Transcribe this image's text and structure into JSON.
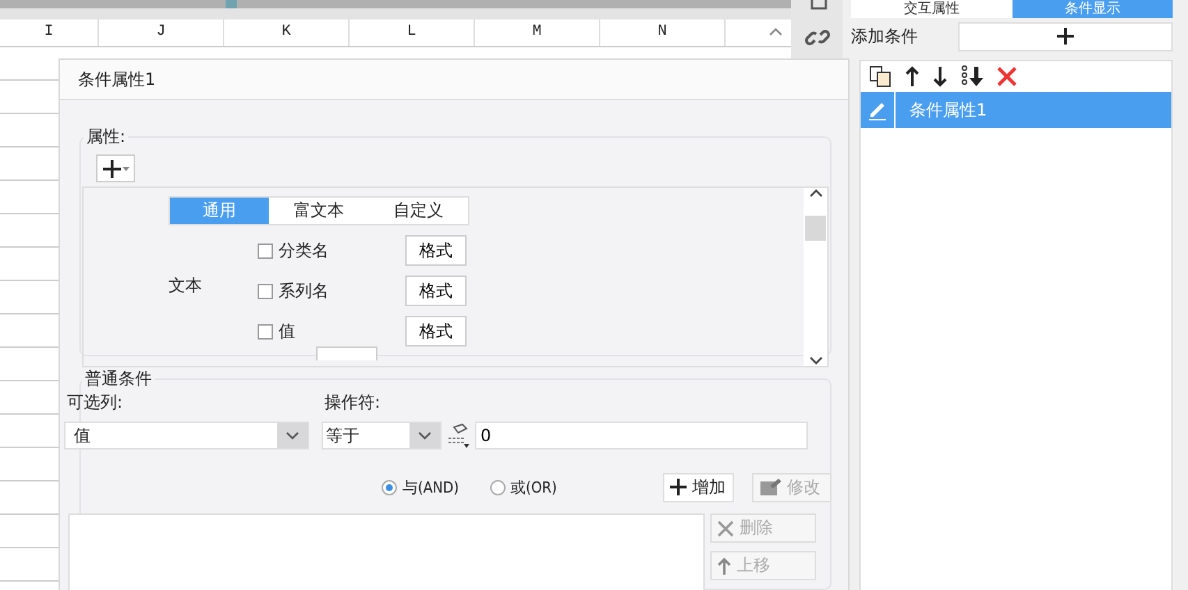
{
  "spreadsheet": {
    "columns": [
      "I",
      "J",
      "K",
      "L",
      "M",
      "N"
    ]
  },
  "side_panel": {
    "tabs": [
      {
        "label": "交互属性",
        "selected": false
      },
      {
        "label": "条件显示",
        "selected": true
      }
    ],
    "add_label": "添加条件",
    "conditions": [
      {
        "label": "条件属性1",
        "selected": true
      }
    ]
  },
  "dialog": {
    "title": "条件属性1",
    "properties": {
      "legend": "属性:",
      "tabs": [
        {
          "label": "通用",
          "selected": true
        },
        {
          "label": "富文本",
          "selected": false
        },
        {
          "label": "自定义",
          "selected": false
        }
      ],
      "section_label": "文本",
      "items": [
        {
          "label": "分类名",
          "checked": false,
          "button": "格式"
        },
        {
          "label": "系列名",
          "checked": false,
          "button": "格式"
        },
        {
          "label": "值",
          "checked": false,
          "button": "格式"
        }
      ]
    },
    "condition": {
      "legend": "普通条件",
      "column_label": "可选列:",
      "column_value": "值",
      "operator_label": "操作符:",
      "operator_value": "等于",
      "value": "0",
      "logic": [
        {
          "label": "与(AND)",
          "selected": true
        },
        {
          "label": "或(OR)",
          "selected": false
        }
      ],
      "buttons": [
        {
          "kind": "add",
          "label": "增加",
          "disabled": false
        },
        {
          "kind": "edit",
          "label": "修改",
          "disabled": true
        },
        {
          "kind": "delete",
          "label": "删除",
          "disabled": true
        },
        {
          "kind": "up",
          "label": "上移",
          "disabled": true
        }
      ]
    }
  }
}
